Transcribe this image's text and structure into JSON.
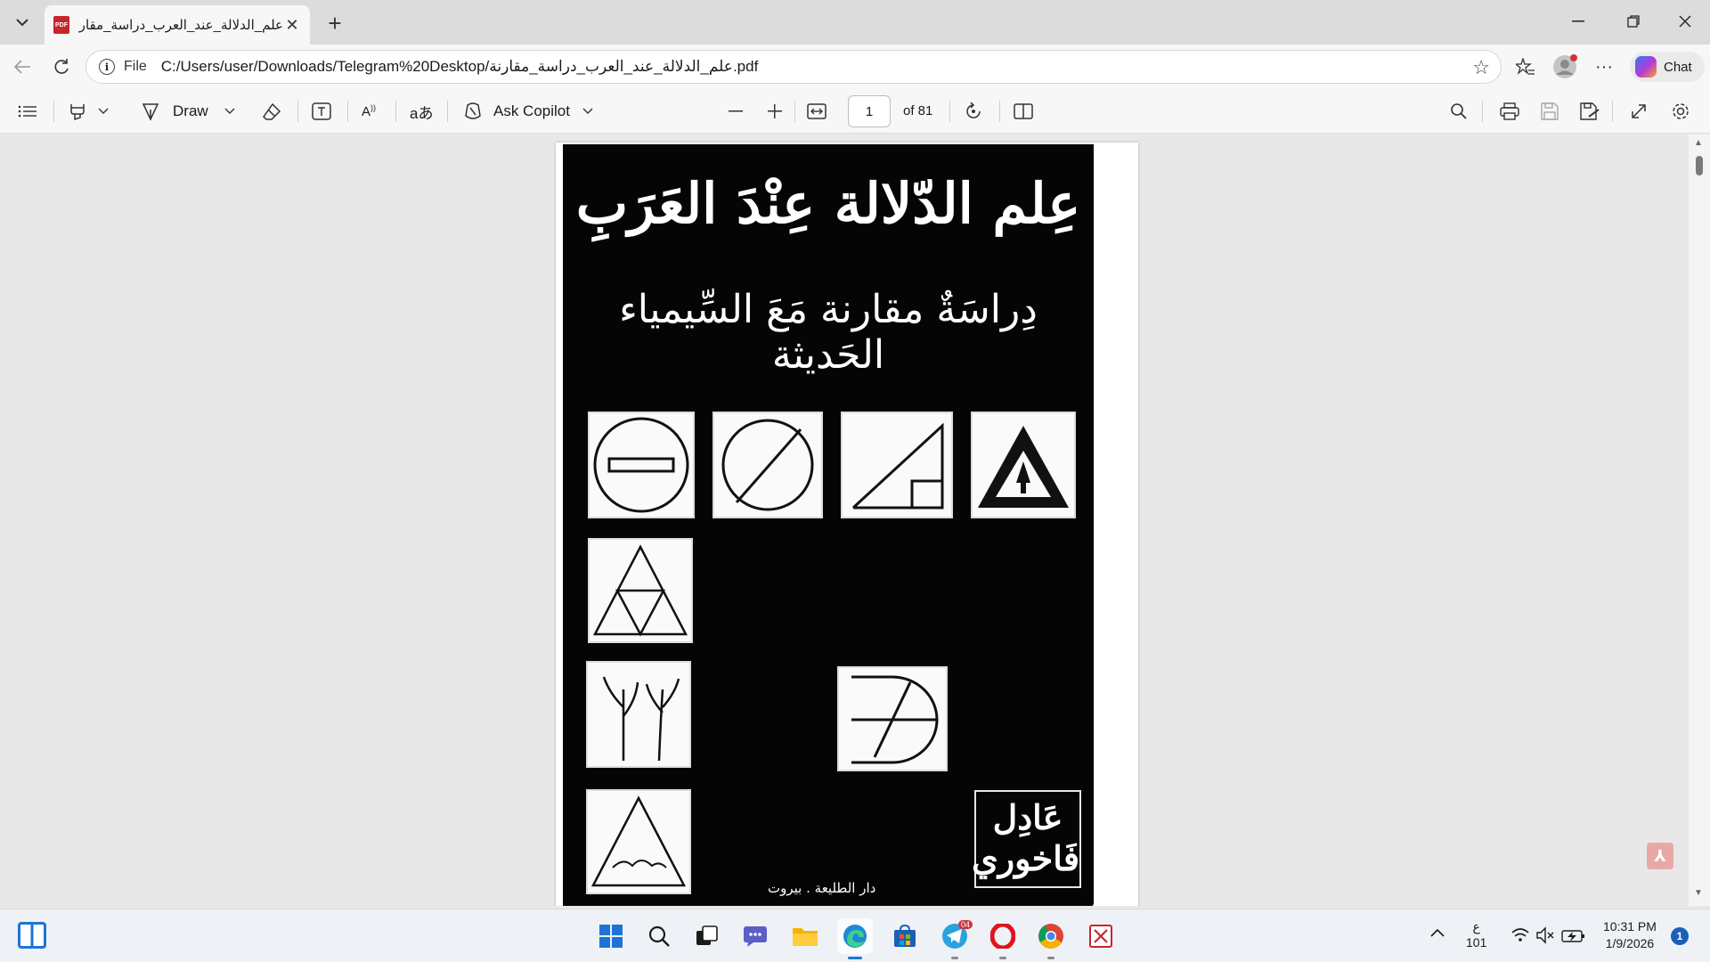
{
  "browser": {
    "tab_title": "علم_الدلالة_عند_العرب_دراسة_مقارنة",
    "tab_favicon_label": "PDF",
    "new_tab": "+",
    "scheme_label": "File",
    "url": "C:/Users/user/Downloads/Telegram%20Desktop/علم_الدلالة_عند_العرب_دراسة_مقارنة.pdf",
    "chat_label": "Chat"
  },
  "pdf_toolbar": {
    "draw_label": "Draw",
    "ask_copilot_label": "Ask Copilot",
    "page_current": "1",
    "page_total": "of 81"
  },
  "document": {
    "title": "عِلم الدّلالة عِنْدَ العَرَبِ",
    "subtitle": "دِراسَةٌ مقارنة مَعَ السِّيمياء الحَديثة",
    "author_first": "عَادِل",
    "author_last": "فَاخوري",
    "publisher": "دار الطليعة . بيروت"
  },
  "taskbar": {
    "telegram_badge": "04",
    "lang_top": "ع",
    "lang_bottom": "101",
    "time": "10:31 PM",
    "date": "1/9/2026",
    "notifications": "1"
  },
  "colors": {
    "accent": "#1e74d6",
    "pdf_red": "#c8262b",
    "cover_black": "#050505"
  }
}
